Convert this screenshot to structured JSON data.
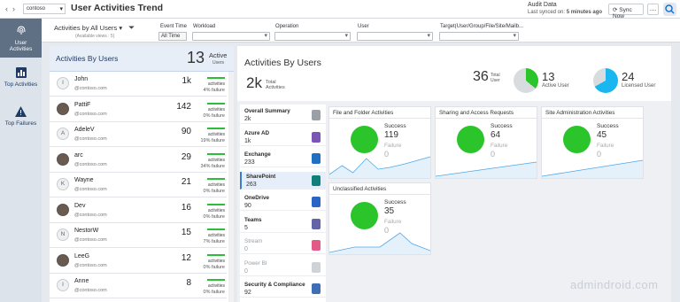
{
  "topbar": {
    "tenant": "contoso",
    "title": "User Activities Trend",
    "audit_title": "Audit Data",
    "last_synced_prefix": "Last synced on:",
    "last_synced_value": "5 minutes ago",
    "sync_label": "Sync Now"
  },
  "sidebar": {
    "items": [
      {
        "label": "User Activities"
      },
      {
        "label": "Top Activities"
      },
      {
        "label": "Top Failures"
      }
    ]
  },
  "filters": {
    "view_label": "Activities by All Users",
    "view_sub": "(Available views : 5)",
    "event_time_label": "Event Time",
    "event_time_value": "All Time",
    "workload_label": "Workload",
    "operation_label": "Operation",
    "user_label": "User",
    "target_label": "Target(User/Group/File/Site/Mailb..."
  },
  "left": {
    "title": "Activities By Users",
    "active_count": "13",
    "active_label_1": "Active",
    "active_label_2": "Users",
    "users": [
      {
        "initial": "I",
        "name": "John",
        "email": "@contoso.com",
        "count": "1k",
        "unit": "activities",
        "fail": "4% failure",
        "photo": false
      },
      {
        "initial": "",
        "name": "PattiF",
        "email": "@contoso.com",
        "count": "142",
        "unit": "activities",
        "fail": "0% failure",
        "photo": true
      },
      {
        "initial": "A",
        "name": "AdeleV",
        "email": "@contoso.com",
        "count": "90",
        "unit": "activities",
        "fail": "19% failure",
        "photo": false
      },
      {
        "initial": "",
        "name": "arc",
        "email": "@contoso.com",
        "count": "29",
        "unit": "activities",
        "fail": "34% failure",
        "photo": true
      },
      {
        "initial": "K",
        "name": "Wayne",
        "email": "@contoso.com",
        "count": "21",
        "unit": "activities",
        "fail": "0% failure",
        "photo": false
      },
      {
        "initial": "",
        "name": "Dev",
        "email": "@contoso.com",
        "count": "16",
        "unit": "activities",
        "fail": "0% failure",
        "photo": true
      },
      {
        "initial": "N",
        "name": "NestorW",
        "email": "@contoso.com",
        "count": "15",
        "unit": "activities",
        "fail": "7% failure",
        "photo": false
      },
      {
        "initial": "",
        "name": "LeeG",
        "email": "@contoso.com",
        "count": "12",
        "unit": "activities",
        "fail": "0% failure",
        "photo": true
      },
      {
        "initial": "I",
        "name": "Anne",
        "email": "@contoso.com",
        "count": "8",
        "unit": "activities",
        "fail": "0% failure",
        "photo": false
      }
    ]
  },
  "main": {
    "title": "Activities By Users",
    "total_count": "2k",
    "total_label": "Total Activities",
    "users_total": "36",
    "users_total_label": "Total User",
    "active_user": "13",
    "active_user_label": "Active User",
    "licensed_user": "24",
    "licensed_user_label": "Licensed User",
    "active_fraction": 0.36,
    "licensed_fraction": 0.67
  },
  "services": [
    {
      "name": "Overall Summary",
      "value": "2k",
      "dim": false,
      "color": "#9aa0a6"
    },
    {
      "name": "Azure AD",
      "value": "1k",
      "dim": false,
      "color": "#7b55b5"
    },
    {
      "name": "Exchange",
      "value": "233",
      "dim": false,
      "color": "#1f6fc2"
    },
    {
      "name": "SharePoint",
      "value": "263",
      "dim": false,
      "color": "#10807a"
    },
    {
      "name": "OneDrive",
      "value": "90",
      "dim": false,
      "color": "#2865c4"
    },
    {
      "name": "Teams",
      "value": "5",
      "dim": false,
      "color": "#6264a7"
    },
    {
      "name": "Stream",
      "value": "0",
      "dim": true,
      "color": "#e35a87"
    },
    {
      "name": "Power BI",
      "value": "0",
      "dim": true,
      "color": "#cfd3d8"
    },
    {
      "name": "Security & Compliance",
      "value": "92",
      "dim": false,
      "color": "#3e6fb5"
    }
  ],
  "cards": [
    {
      "title": "File and Folder Activities",
      "success_label": "Success",
      "success": "119",
      "failure_label": "Failure",
      "failure": "0"
    },
    {
      "title": "Sharing and Access Requests",
      "success_label": "Success",
      "success": "64",
      "failure_label": "Failure",
      "failure": "0"
    },
    {
      "title": "Site Administration Activities",
      "success_label": "Success",
      "success": "45",
      "failure_label": "Failure",
      "failure": "0"
    },
    {
      "title": "Unclassified Activities",
      "success_label": "Success",
      "success": "35",
      "failure_label": "Failure",
      "failure": "0"
    }
  ],
  "watermark": "admindroid.com"
}
